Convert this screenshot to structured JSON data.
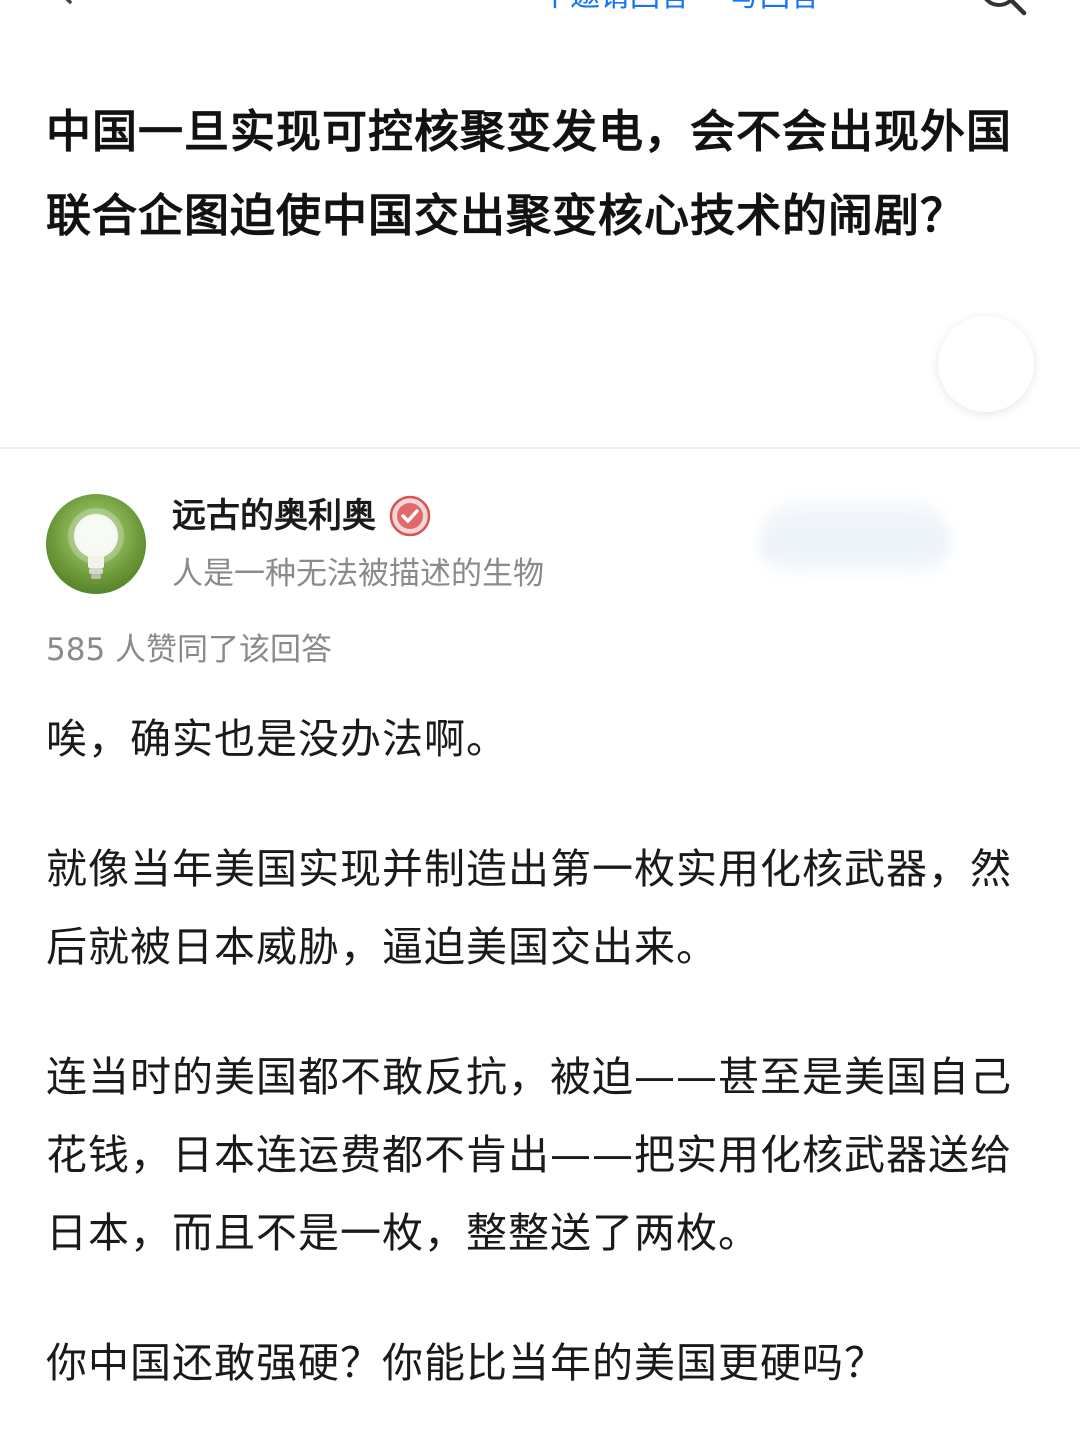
{
  "nav": {
    "back_icon": "back-arrow-icon",
    "links": [
      "个邀请回答",
      "写回答"
    ],
    "search_icon": "search-icon",
    "accent_color": "#1772f6"
  },
  "question": {
    "title": "中国一旦实现可控核聚变发电，会不会出现外国联合企图迫使中国交出聚变核心技术的闹剧？"
  },
  "answer": {
    "author": {
      "name": "远古的奥利奥",
      "bio": "人是一种无法被描述的生物",
      "avatar_icon": "lightbulb-icon",
      "badge_icon": "verified-badge-icon"
    },
    "vote_text": "585 人赞同了该回答",
    "paragraphs": [
      "唉，确实也是没办法啊。",
      "就像当年美国实现并制造出第一枚实用化核武器，然后就被日本威胁，逼迫美国交出来。",
      "连当时的美国都不敢反抗，被迫——甚至是美国自己花钱，日本连运费都不肯出——把实用化核武器送给日本，而且不是一枚，整整送了两枚。",
      "你中国还敢强硬？你能比当年的美国更硬吗？"
    ]
  }
}
